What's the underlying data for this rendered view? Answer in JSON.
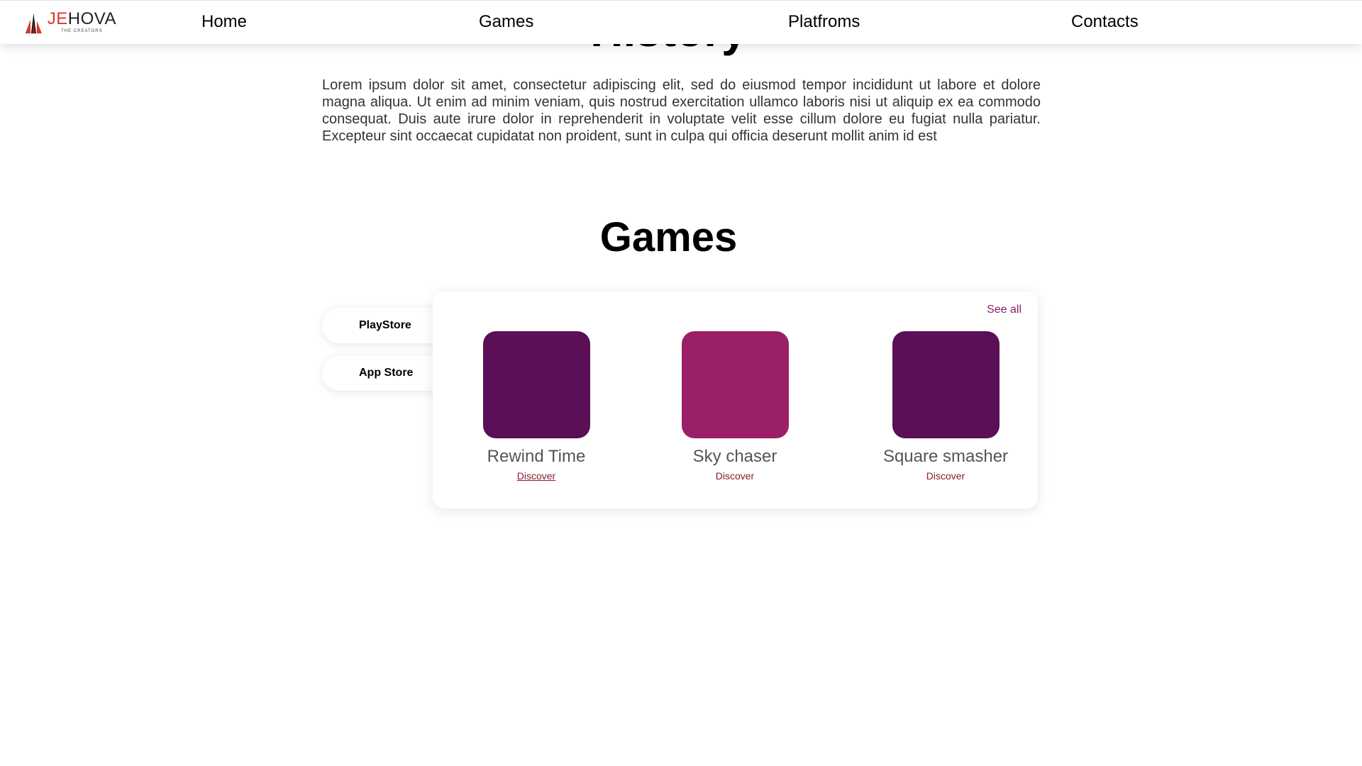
{
  "header": {
    "logo": {
      "text_accent": "JE",
      "text_main": "HOVA",
      "subtitle": "THE CREATORS",
      "icon": "logo-tower-icon"
    },
    "nav": [
      {
        "label": "Home"
      },
      {
        "label": "Games"
      },
      {
        "label": "Platfroms"
      },
      {
        "label": "Contacts"
      }
    ]
  },
  "history": {
    "heading": "History",
    "paragraph": "Lorem ipsum dolor sit amet, consectetur adipiscing elit, sed do eiusmod tempor incididunt ut labore et dolore magna aliqua. Ut enim ad minim veniam, quis nostrud exercitation ullamco laboris nisi ut aliquip ex ea commodo consequat. Duis aute irure dolor in reprehenderit in voluptate velit esse cillum dolore eu fugiat nulla pariatur. Excepteur sint occaecat cupidatat non proident, sunt in culpa qui officia deserunt mollit anim id est"
  },
  "games_section": {
    "title": "Games",
    "platform_tabs": [
      {
        "label": "PlayStore"
      },
      {
        "label": "App Store"
      }
    ],
    "see_all_label": "See all",
    "games": [
      {
        "title": "Rewind Time",
        "action": "Discover",
        "color": "#5a0f57"
      },
      {
        "title": "Sky chaser",
        "action": "Discover",
        "color": "#9b1f65"
      },
      {
        "title": "Square smasher",
        "action": "Discover",
        "color": "#5a0f57"
      }
    ]
  },
  "colors": {
    "accent_red": "#d9372b",
    "link_purple": "#8c1d6a",
    "discover_red": "#8a1a2e"
  }
}
